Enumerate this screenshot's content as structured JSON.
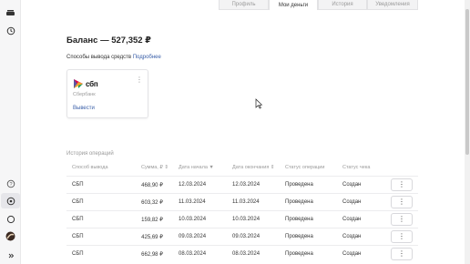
{
  "tabs": [
    {
      "label": "Профиль",
      "active": false
    },
    {
      "label": "Мои деньги",
      "active": true
    },
    {
      "label": "История",
      "active": false
    },
    {
      "label": "Уведомления",
      "active": false
    }
  ],
  "balance": {
    "text": "Баланс — 527,352 ₽"
  },
  "methods": {
    "label": "Способы вывода средств",
    "link": "Подробнее"
  },
  "card": {
    "brand": "сбп",
    "bank": "Сбербанк",
    "action": "Вывести",
    "menu_icon": "⋮"
  },
  "history": {
    "title": "История операций",
    "headers": [
      "Способ вывода",
      "Сумма, ₽ ⇕",
      "Дата начала ▼",
      "Дата окончания ⇕",
      "Статус операции",
      "Статус чека"
    ],
    "rows": [
      {
        "method": "СБП",
        "amount": "468,90 ₽",
        "start": "12.03.2024",
        "end": "12.03.2024",
        "status": "Проведена",
        "receipt": "Создан"
      },
      {
        "method": "СБП",
        "amount": "603,32 ₽",
        "start": "11.03.2024",
        "end": "11.03.2024",
        "status": "Проведена",
        "receipt": "Создан"
      },
      {
        "method": "СБП",
        "amount": "159,82 ₽",
        "start": "10.03.2024",
        "end": "10.03.2024",
        "status": "Проведена",
        "receipt": "Создан"
      },
      {
        "method": "СБП",
        "amount": "425,69 ₽",
        "start": "09.03.2024",
        "end": "09.03.2024",
        "status": "Проведена",
        "receipt": "Создан"
      },
      {
        "method": "СБП",
        "amount": "662,98 ₽",
        "start": "08.03.2024",
        "end": "08.03.2024",
        "status": "Проведена",
        "receipt": "Создан"
      }
    ],
    "row_action_icon": "⋮"
  },
  "sidebar": {
    "icons": [
      "brand-icon",
      "history-icon",
      "help-icon",
      "wallet-icon",
      "chat-icon",
      "avatar",
      "expand-icon"
    ]
  },
  "colors": {
    "accent": "#3a5fa8",
    "sbp": [
      "#5b57a2",
      "#d90751",
      "#f9b229",
      "#0f9d58"
    ]
  }
}
